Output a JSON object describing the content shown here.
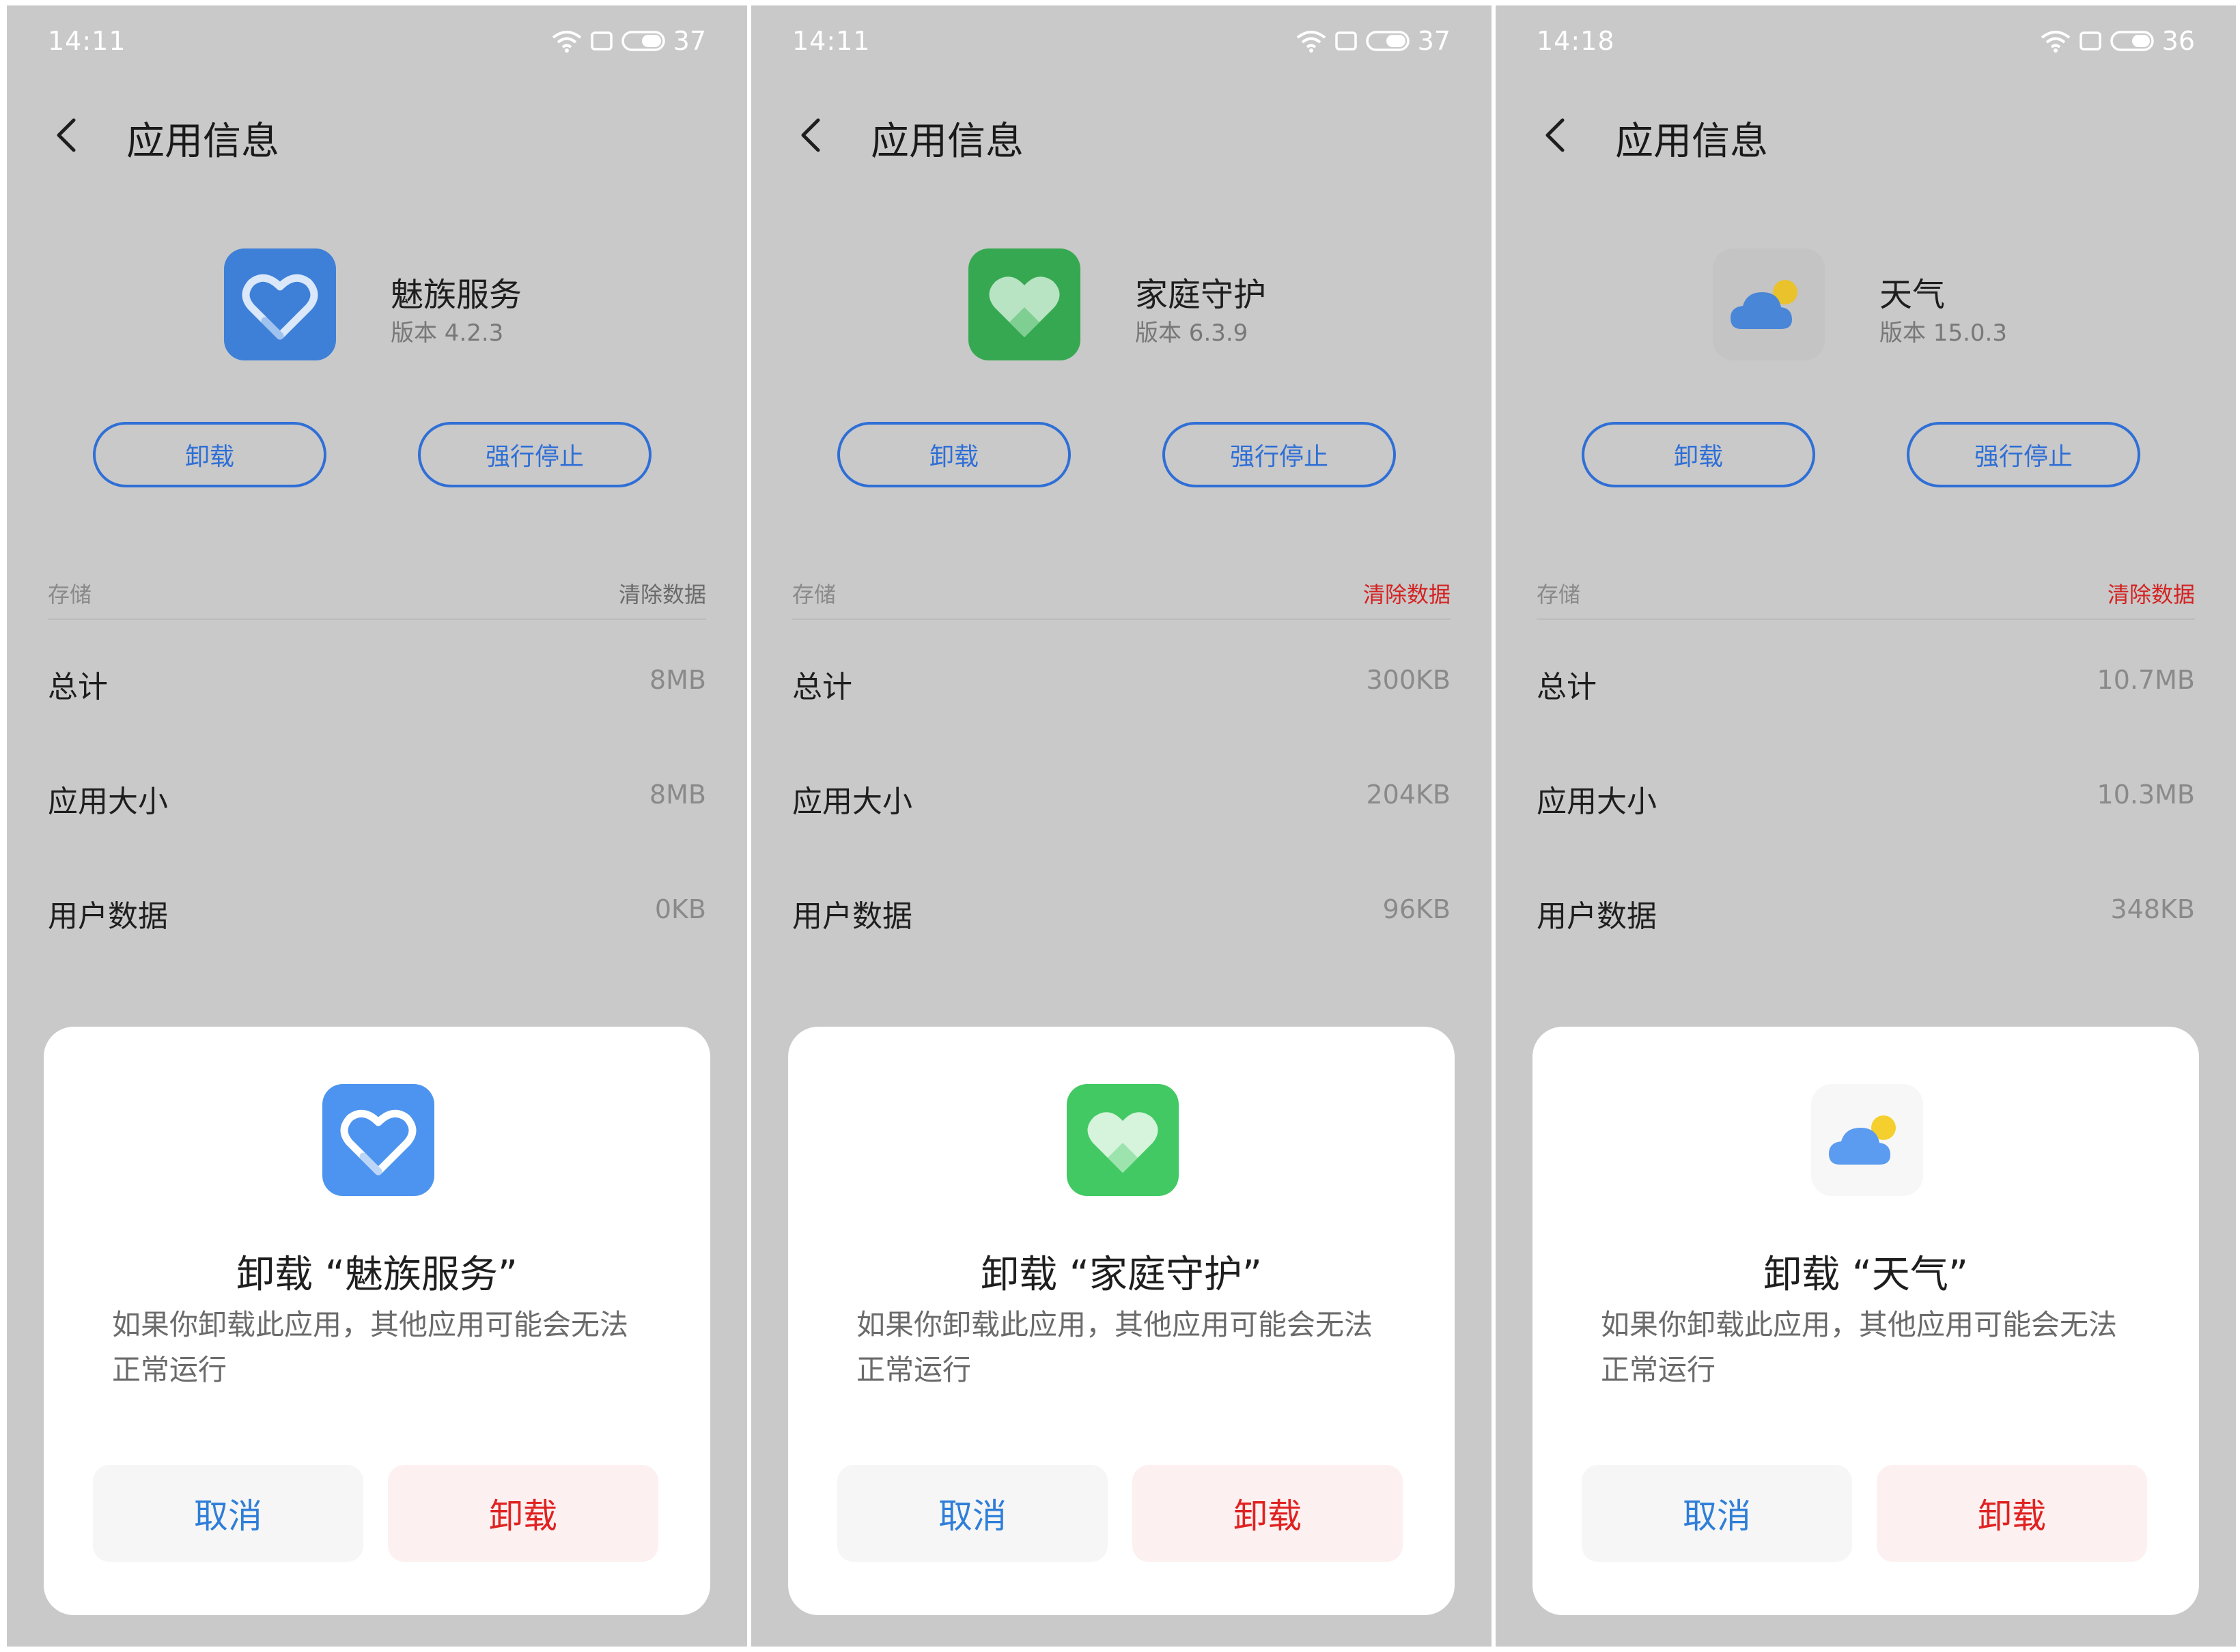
{
  "panels": [
    {
      "status": {
        "time": "14:11",
        "battery": "37"
      },
      "header": {
        "title": "应用信息"
      },
      "app": {
        "name": "魅族服务",
        "version": "版本 4.2.3",
        "icon": "heart-outline-icon"
      },
      "actions": {
        "uninstall": "卸载",
        "force_stop": "强行停止"
      },
      "storage": {
        "label": "存储",
        "clear_data": "清除数据",
        "clear_data_color": "#6a6a6a",
        "rows": [
          {
            "label": "总计",
            "value": "8MB"
          },
          {
            "label": "应用大小",
            "value": "8MB"
          },
          {
            "label": "用户数据",
            "value": "0KB"
          }
        ]
      },
      "dialog": {
        "title": "卸载 “魅族服务”",
        "message": "如果你卸载此应用，其他应用可能会无法正常运行",
        "cancel": "取消",
        "confirm": "卸载"
      }
    },
    {
      "status": {
        "time": "14:11",
        "battery": "37"
      },
      "header": {
        "title": "应用信息"
      },
      "app": {
        "name": "家庭守护",
        "version": "版本 6.3.9",
        "icon": "heart-filled-icon"
      },
      "actions": {
        "uninstall": "卸载",
        "force_stop": "强行停止"
      },
      "storage": {
        "label": "存储",
        "clear_data": "清除数据",
        "clear_data_color": "#d42222",
        "rows": [
          {
            "label": "总计",
            "value": "300KB"
          },
          {
            "label": "应用大小",
            "value": "204KB"
          },
          {
            "label": "用户数据",
            "value": "96KB"
          }
        ]
      },
      "dialog": {
        "title": "卸载 “家庭守护”",
        "message": "如果你卸载此应用，其他应用可能会无法正常运行",
        "cancel": "取消",
        "confirm": "卸载"
      }
    },
    {
      "status": {
        "time": "14:18",
        "battery": "36"
      },
      "header": {
        "title": "应用信息"
      },
      "app": {
        "name": "天气",
        "version": "版本 15.0.3",
        "icon": "weather-cloud-sun-icon"
      },
      "actions": {
        "uninstall": "卸载",
        "force_stop": "强行停止"
      },
      "storage": {
        "label": "存储",
        "clear_data": "清除数据",
        "clear_data_color": "#d42222",
        "rows": [
          {
            "label": "总计",
            "value": "10.7MB"
          },
          {
            "label": "应用大小",
            "value": "10.3MB"
          },
          {
            "label": "用户数据",
            "value": "348KB"
          }
        ]
      },
      "dialog": {
        "title": "卸载 “天气”",
        "message": "如果你卸载此应用，其他应用可能会无法正常运行",
        "cancel": "取消",
        "confirm": "卸载"
      }
    }
  ],
  "colors": {
    "accent": "#2f6fd6",
    "danger": "#e02222",
    "meizu_blue": "#3b82e0",
    "family_green": "#3aad56"
  }
}
